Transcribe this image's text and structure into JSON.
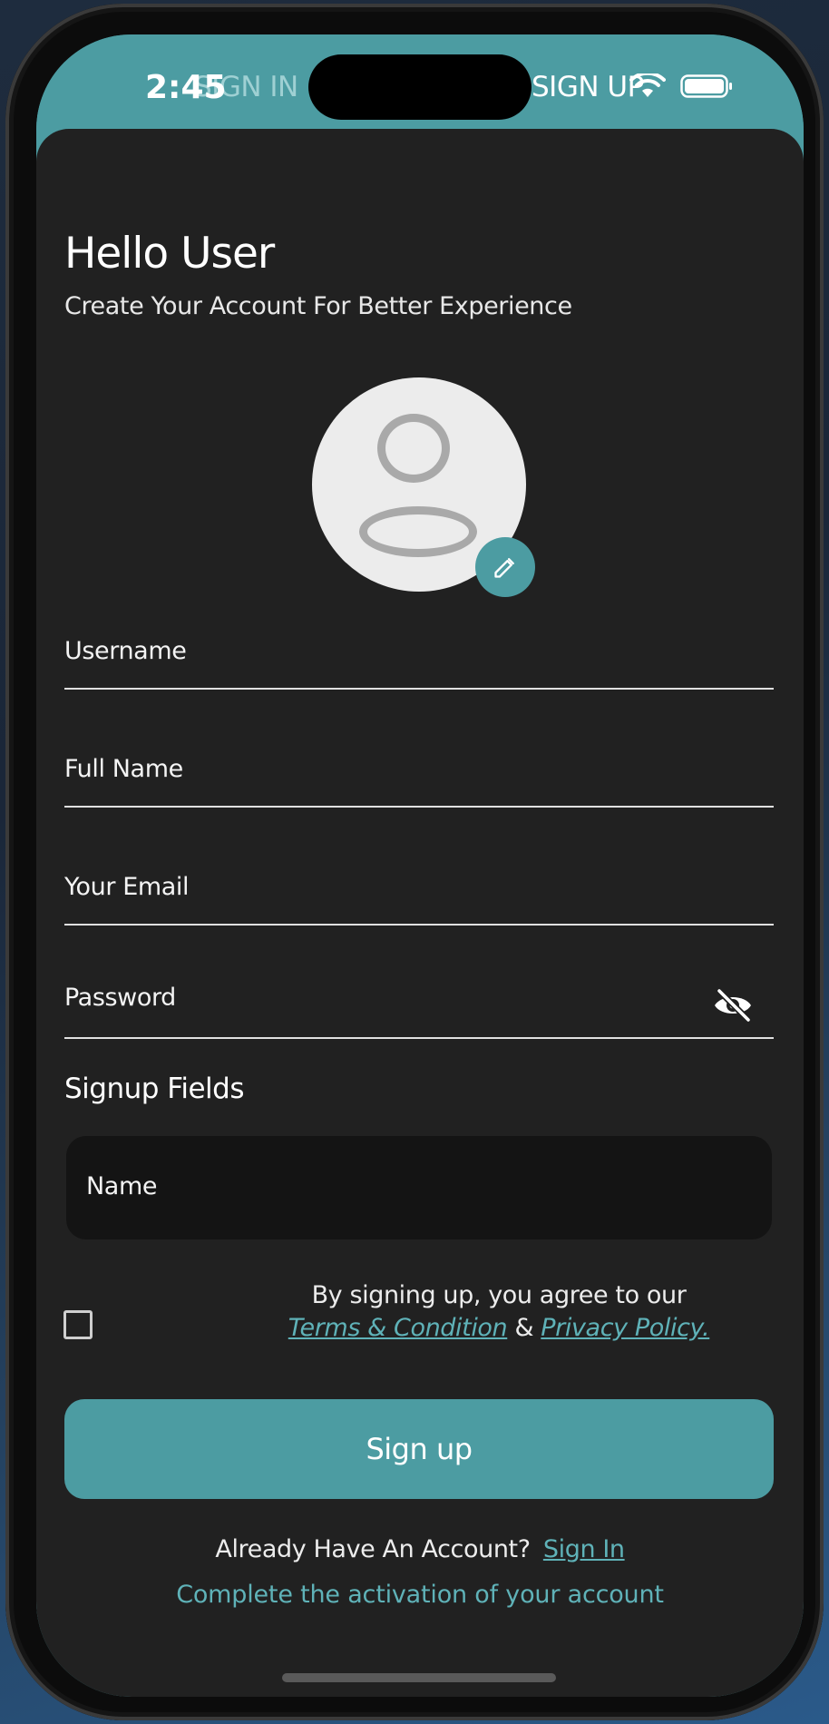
{
  "status_bar": {
    "time": "2:45"
  },
  "tabs": [
    {
      "label": "SIGN IN",
      "active": false
    },
    {
      "label": "SIGN UP",
      "active": true
    }
  ],
  "header": {
    "title": "Hello User",
    "subtitle": "Create Your Account For Better Experience"
  },
  "form": {
    "username_label": "Username",
    "fullname_label": "Full Name",
    "email_label": "Your Email",
    "password_label": "Password"
  },
  "signup_fields": {
    "title": "Signup Fields",
    "name_label": "Name"
  },
  "terms": {
    "prefix": "By signing up, you agree to our",
    "terms_link": "Terms & Condition",
    "separator": " & ",
    "privacy_link": "Privacy Policy.",
    "checked": false
  },
  "signup_button": {
    "label": "Sign up"
  },
  "footer": {
    "already_text": "Already Have An Account?",
    "signin_link": "Sign In",
    "activation_link": "Complete the activation of your account"
  },
  "colors": {
    "accent": "#4c9ca2",
    "sheet_background": "#212121",
    "input_box_background": "#141414",
    "link": "#5fb2b8"
  },
  "icons": [
    "wifi-icon",
    "battery-icon",
    "avatar-placeholder-icon",
    "pencil-icon",
    "eye-off-icon"
  ]
}
